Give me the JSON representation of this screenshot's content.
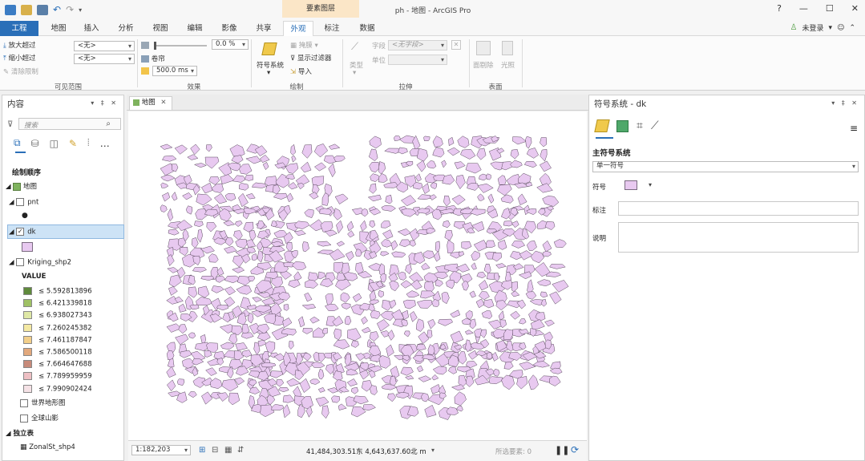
{
  "window": {
    "title": "ph - 地图 - ArcGIS Pro",
    "context_tab_group": "要素图层",
    "help": "?",
    "minimize": "—",
    "maximize": "☐",
    "close": "✕"
  },
  "tabs": [
    "工程",
    "地图",
    "插入",
    "分析",
    "视图",
    "编辑",
    "影像",
    "共享",
    "外观",
    "标注",
    "数据"
  ],
  "user": {
    "label": "未登录",
    "avatar_icon": "person-icon"
  },
  "ribbon": {
    "visible_range": {
      "zoom_in_beyond": "放大超过",
      "zoom_out_beyond": "缩小超过",
      "clear_limits": "清除限制",
      "zoom_in_value": "<无>",
      "zoom_out_value": "<无>",
      "label": "可见范围"
    },
    "effects": {
      "transparency_value": "0.0 %",
      "swipe": "卷帘",
      "flicker_value": "500.0  ms",
      "label": "效果"
    },
    "drawing": {
      "symbology": "符号系统",
      "mask": "掩膜",
      "display_filters": "显示过滤器",
      "import": "导入",
      "label": "绘制"
    },
    "extrusion": {
      "type": "类型",
      "field": "字段",
      "field_value": "<无字段>",
      "unit": "单位",
      "label": "拉伸"
    },
    "faces": {
      "face_culling": "面剔除",
      "lighting": "光照",
      "label": "表面"
    }
  },
  "contents": {
    "title": "内容",
    "search_placeholder": "搜索",
    "drawing_order": "绘制顺序",
    "map": "地图",
    "layers": {
      "pnt": "pnt",
      "dk": "dk",
      "kriging": "Kriging_shp2",
      "value_header": "VALUE",
      "world_topo": "世界地形图",
      "world_hillshade": "全球山影",
      "standalone_tables": "独立表",
      "zonal": "ZonalSt_shp4"
    },
    "legend": [
      {
        "label": "≤ 5.592813896",
        "color": "#5f8a3c"
      },
      {
        "label": "≤ 6.421339818",
        "color": "#9fc165"
      },
      {
        "label": "≤ 6.938027343",
        "color": "#dfe8a6"
      },
      {
        "label": "≤ 7.260245382",
        "color": "#f4e9a3"
      },
      {
        "label": "≤ 7.461187847",
        "color": "#f2cf8a"
      },
      {
        "label": "≤ 7.586500118",
        "color": "#e2a97d"
      },
      {
        "label": "≤ 7.664647688",
        "color": "#c78a7a"
      },
      {
        "label": "≤ 7.789959959",
        "color": "#eec0c4"
      },
      {
        "label": "≤ 7.990902424",
        "color": "#f5e2e6"
      }
    ],
    "dk_color": "#e8c9f0"
  },
  "map_view": {
    "tab_label": "地图",
    "scale": "1:182,203",
    "coordinates": "41,484,303.51东 4,643,637.60北 m",
    "selected_features": "所选要素: 0",
    "parcel_fill": "#e8c9f0",
    "parcel_stroke": "#5a4a5e"
  },
  "symbology": {
    "title": "符号系统 - dk",
    "primary": "主符号系统",
    "method": "单一符号",
    "symbol_label": "符号",
    "label_label": "标注",
    "description_label": "说明",
    "symbol_color": "#e8c9f0"
  }
}
